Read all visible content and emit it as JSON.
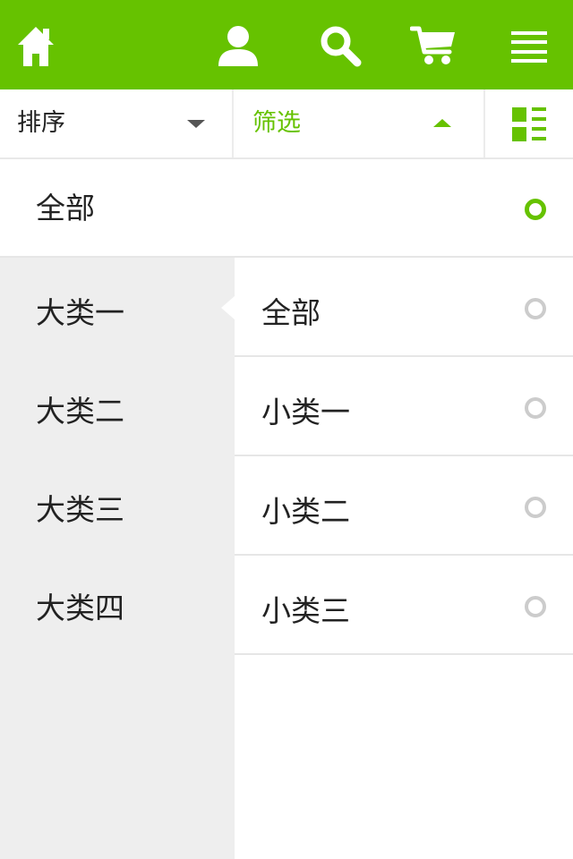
{
  "colors": {
    "accent": "#66c200",
    "radio_off": "#cccccc",
    "category_bg": "#eeeeee"
  },
  "header": {
    "icons": [
      "home-icon",
      "user-icon",
      "search-icon",
      "cart-icon",
      "menu-icon"
    ]
  },
  "toolbar": {
    "sort_label": "排序",
    "filter_label": "筛选",
    "view_icon": "grid-list-icon"
  },
  "filter_panel": {
    "all_option": {
      "label": "全部",
      "selected": true
    },
    "categories": [
      {
        "label": "大类一",
        "active": true
      },
      {
        "label": "大类二",
        "active": false
      },
      {
        "label": "大类三",
        "active": false
      },
      {
        "label": "大类四",
        "active": false
      }
    ],
    "subcategories": [
      {
        "label": "全部",
        "selected": false
      },
      {
        "label": "小类一",
        "selected": false
      },
      {
        "label": "小类二",
        "selected": false
      },
      {
        "label": "小类三",
        "selected": false
      }
    ]
  }
}
